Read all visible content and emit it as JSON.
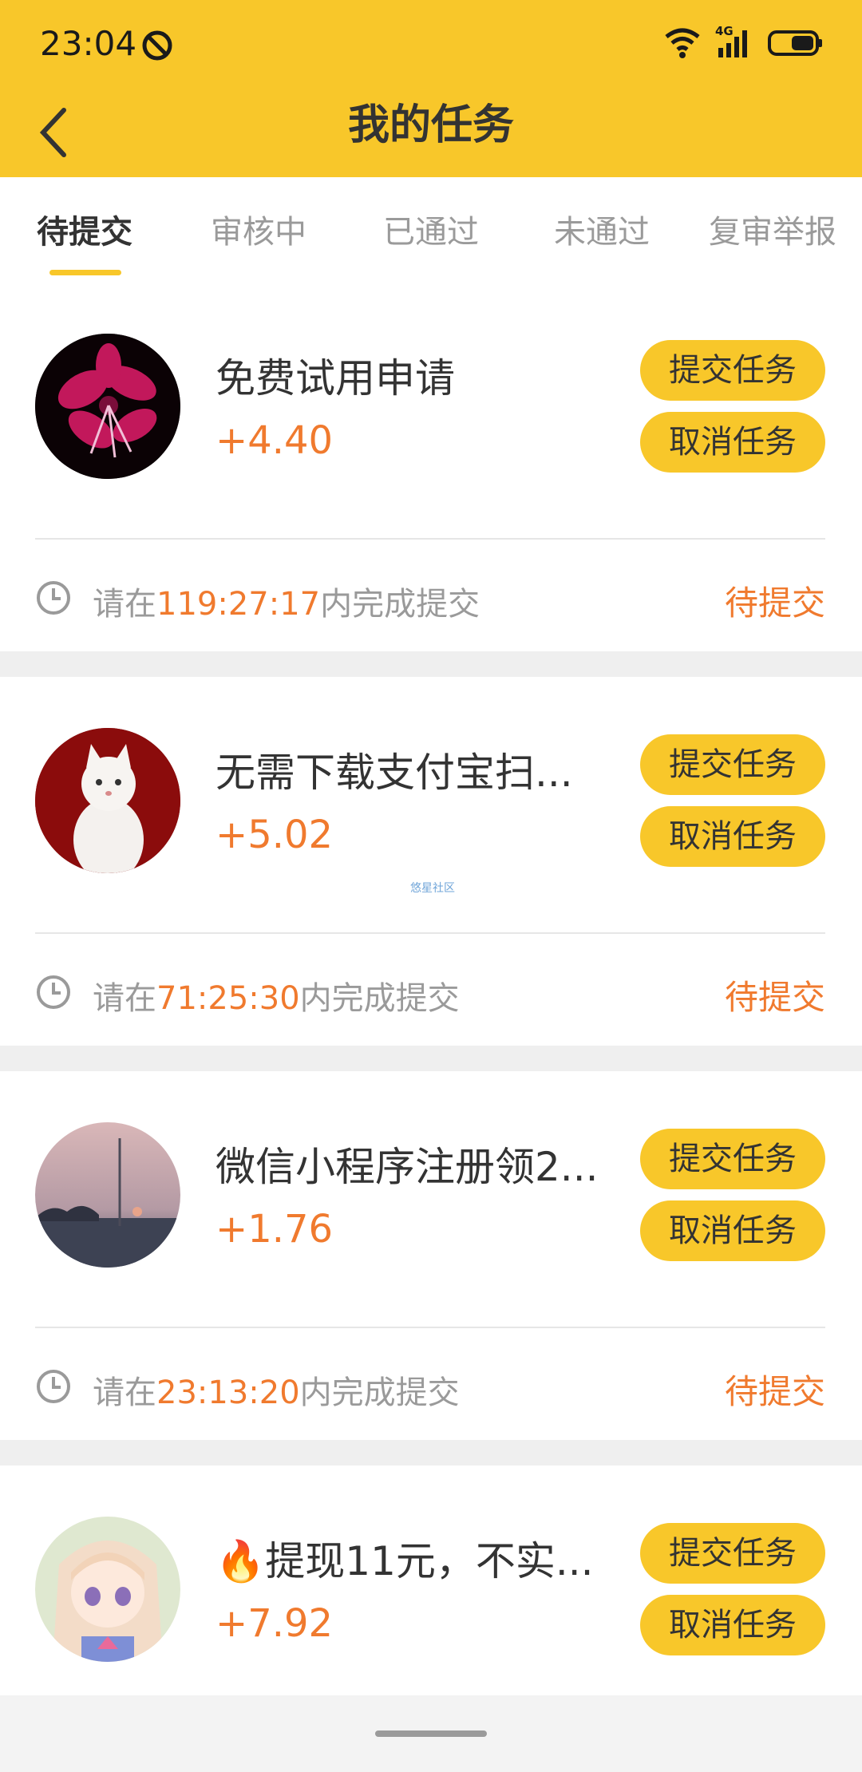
{
  "status_bar": {
    "time": "23:04",
    "network": "4G",
    "icons": [
      "do-not-disturb-icon",
      "wifi-icon",
      "signal-icon",
      "battery-icon"
    ]
  },
  "header": {
    "title": "我的任务",
    "back_icon": "chevron-left-icon"
  },
  "tabs": [
    {
      "label": "待提交",
      "active": true
    },
    {
      "label": "审核中",
      "active": false
    },
    {
      "label": "已通过",
      "active": false
    },
    {
      "label": "未通过",
      "active": false
    },
    {
      "label": "复审举报",
      "active": false
    }
  ],
  "tasks": [
    {
      "title": "免费试用申请",
      "reward": "+4.40",
      "submit_label": "提交任务",
      "cancel_label": "取消任务",
      "deadline_prefix": "请在",
      "deadline_time": "119:27:17",
      "deadline_suffix": "内完成提交",
      "status": "待提交"
    },
    {
      "title": "无需下载支付宝扫...",
      "reward": "+5.02",
      "submit_label": "提交任务",
      "cancel_label": "取消任务",
      "deadline_prefix": "请在",
      "deadline_time": "71:25:30",
      "deadline_suffix": "内完成提交",
      "status": "待提交"
    },
    {
      "title": "微信小程序注册领2...",
      "reward": "+1.76",
      "submit_label": "提交任务",
      "cancel_label": "取消任务",
      "deadline_prefix": "请在",
      "deadline_time": "23:13:20",
      "deadline_suffix": "内完成提交",
      "status": "待提交"
    },
    {
      "title": "🔥提现11元，不实...",
      "reward": "+7.92",
      "submit_label": "提交任务",
      "cancel_label": "取消任务"
    }
  ],
  "watermark": "悠星社区",
  "colors": {
    "brand_yellow": "#f8c72a",
    "accent_orange": "#f07a2e",
    "text_dark": "#333333",
    "text_gray": "#9a9a9a"
  }
}
